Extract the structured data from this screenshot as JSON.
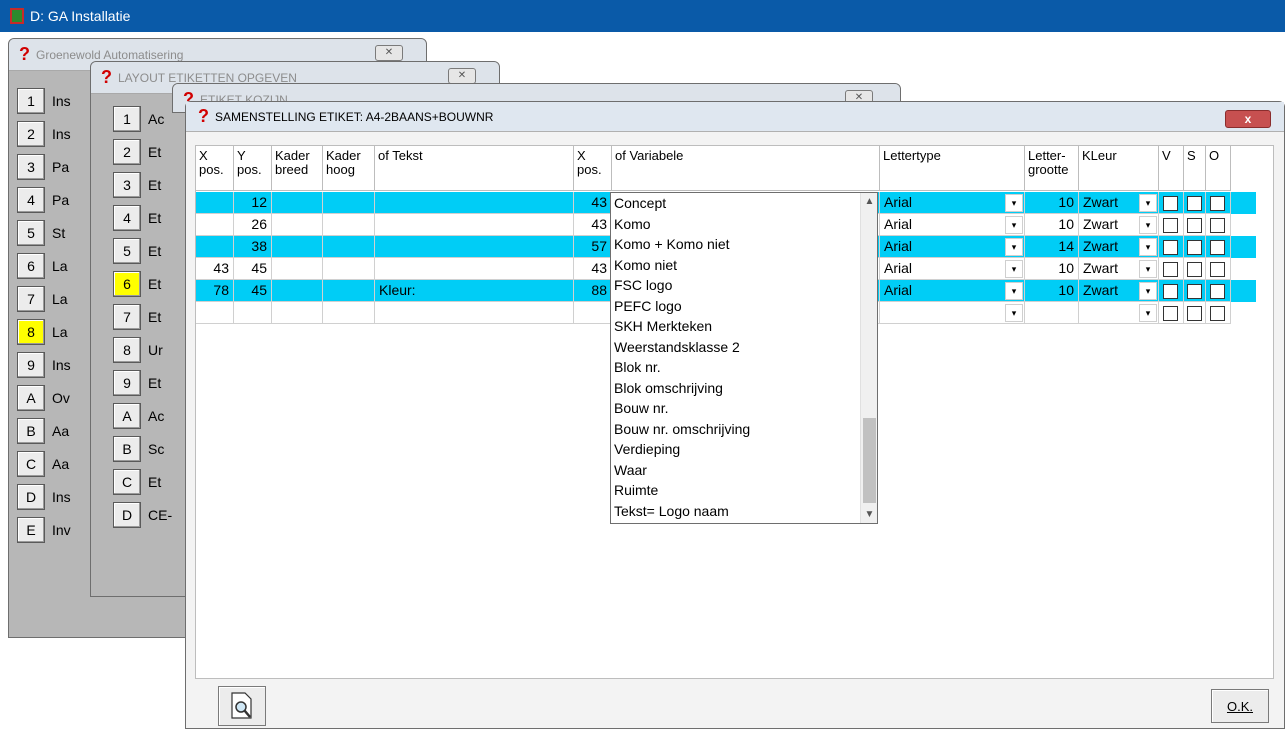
{
  "app": {
    "title": "D: GA Installatie"
  },
  "dialog1": {
    "title": "Groenewold Automatisering",
    "keys": [
      {
        "key": "1",
        "label": "Ins"
      },
      {
        "key": "2",
        "label": "Ins"
      },
      {
        "key": "3",
        "label": "Pa"
      },
      {
        "key": "4",
        "label": "Pa"
      },
      {
        "key": "5",
        "label": "St"
      },
      {
        "key": "6",
        "label": "La"
      },
      {
        "key": "7",
        "label": "La"
      },
      {
        "key": "8",
        "label": "La"
      },
      {
        "key": "9",
        "label": "Ins"
      },
      {
        "key": "A",
        "label": "Ov"
      },
      {
        "key": "B",
        "label": "Aa"
      },
      {
        "key": "C",
        "label": "Aa"
      },
      {
        "key": "D",
        "label": "Ins"
      },
      {
        "key": "E",
        "label": "Inv"
      }
    ]
  },
  "dialog2": {
    "title": "LAYOUT ETIKETTEN OPGEVEN",
    "keys": [
      {
        "key": "1",
        "label": "Ac"
      },
      {
        "key": "2",
        "label": "Et"
      },
      {
        "key": "3",
        "label": "Et"
      },
      {
        "key": "4",
        "label": "Et"
      },
      {
        "key": "5",
        "label": "Et"
      },
      {
        "key": "6",
        "label": "Et"
      },
      {
        "key": "7",
        "label": "Et"
      },
      {
        "key": "8",
        "label": "Ur"
      },
      {
        "key": "9",
        "label": "Et"
      },
      {
        "key": "A",
        "label": "Ac"
      },
      {
        "key": "B",
        "label": "Sc"
      },
      {
        "key": "C",
        "label": "Et"
      },
      {
        "key": "D",
        "label": "CE-"
      }
    ]
  },
  "dialog3": {
    "title": "ETIKET KOZIJN"
  },
  "main": {
    "title": "SAMENSTELLING ETIKET: A4-2BAANS+BOUWNR",
    "close": "x",
    "headers": {
      "xpos": "X pos.",
      "ypos": "Y pos.",
      "kbreed": "Kader breed",
      "khoog": "Kader hoog",
      "tekst": "of Tekst",
      "xpos2": "X pos.",
      "variabele": "of Variabele",
      "lettertype": "Lettertype",
      "grootte": "Letter- grootte",
      "kleur": "KLeur",
      "v": "V",
      "s": "S",
      "o": "O"
    },
    "rows": [
      {
        "x": "",
        "y": "12",
        "tekst": "",
        "x2": "43",
        "font": "Arial",
        "size": "10",
        "color": "Zwart",
        "hl": true
      },
      {
        "x": "",
        "y": "26",
        "tekst": "",
        "x2": "43",
        "font": "Arial",
        "size": "10",
        "color": "Zwart",
        "hl": false
      },
      {
        "x": "",
        "y": "38",
        "tekst": "",
        "x2": "57",
        "font": "Arial",
        "size": "14",
        "color": "Zwart",
        "hl": true
      },
      {
        "x": "43",
        "y": "45",
        "tekst": "",
        "x2": "43",
        "font": "Arial",
        "size": "10",
        "color": "Zwart",
        "hl": false
      },
      {
        "x": "78",
        "y": "45",
        "tekst": "Kleur:",
        "x2": "88",
        "font": "Arial",
        "size": "10",
        "color": "Zwart",
        "hl": true
      },
      {
        "x": "",
        "y": "",
        "tekst": "",
        "x2": "",
        "font": "",
        "size": "",
        "color": "",
        "hl": false
      }
    ],
    "variables": [
      "Concept",
      "Komo",
      "Komo + Komo niet",
      "Komo niet",
      "FSC logo",
      "PEFC logo",
      "SKH Merkteken",
      "Weerstandsklasse 2",
      "Blok nr.",
      "Blok omschrijving",
      "Bouw nr.",
      "Bouw nr. omschrijving",
      "Verdieping",
      "Waar",
      "Ruimte",
      "Tekst= Logo naam"
    ],
    "ok_label": "O.K.",
    "highlight_color": "#00cdf6"
  }
}
